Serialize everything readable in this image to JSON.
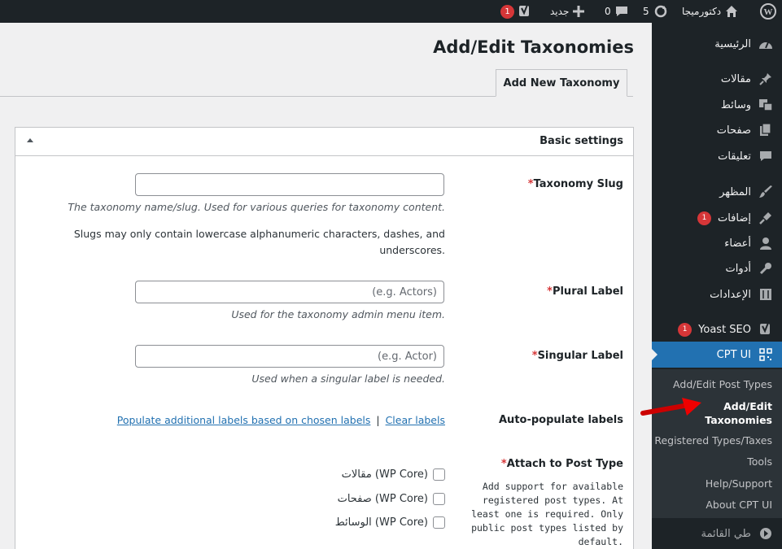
{
  "adminbar": {
    "wp_logo": "wordpress-icon",
    "site_name": "دكتورميجا",
    "updates_count": "5",
    "comments_count": "0",
    "new_label": "جديد",
    "yoast_badge": "1"
  },
  "sidebar": {
    "items": [
      {
        "label": "الرئيسية",
        "icon": "dashboard-icon"
      },
      {
        "label": "مقالات",
        "icon": "pin-icon"
      },
      {
        "label": "وسائط",
        "icon": "media-icon"
      },
      {
        "label": "صفحات",
        "icon": "pages-icon"
      },
      {
        "label": "تعليقات",
        "icon": "comments-icon"
      },
      {
        "label": "المظهر",
        "icon": "appearance-icon"
      },
      {
        "label": "إضافات",
        "icon": "plugins-icon",
        "badge": "1"
      },
      {
        "label": "أعضاء",
        "icon": "users-icon"
      },
      {
        "label": "أدوات",
        "icon": "tools-icon"
      },
      {
        "label": "الإعدادات",
        "icon": "settings-icon"
      },
      {
        "label": "Yoast SEO",
        "icon": "yoast-icon",
        "badge": "1"
      },
      {
        "label": "CPT UI",
        "icon": "cptui-icon"
      }
    ],
    "submenu": [
      "Add/Edit Post Types",
      "Add/Edit Taxonomies",
      "Registered Types/Taxes",
      "Tools",
      "Help/Support",
      "About CPT UI"
    ],
    "collapse_label": "طي القائمة"
  },
  "page": {
    "title": "Add/Edit Taxonomies",
    "tab": "Add New Taxonomy"
  },
  "box": {
    "title": "Basic settings",
    "slug_label": "Taxonomy Slug",
    "slug_desc": "The taxonomy name/slug. Used for various queries for taxonomy content.",
    "slug_note": "Slugs may only contain lowercase alphanumeric characters, dashes, and underscores.",
    "plural_label": "Plural Label",
    "plural_placeholder": "(e.g. Actors)",
    "plural_desc": "Used for the taxonomy admin menu item.",
    "singular_label": "Singular Label",
    "singular_placeholder": "(e.g. Actor)",
    "singular_desc": "Used when a singular label is needed.",
    "autopop_label": "Auto-populate labels",
    "autopop_link": "Populate additional labels based on chosen labels",
    "separator": "|",
    "clear_link": "Clear labels",
    "attach_label": "Attach to Post Type",
    "attach_help": "Add support for available registered post types. At least one is required. Only public post types listed by default.",
    "post_types": [
      "مقالات (WP Core)",
      "صفحات (WP Core)",
      "الوسائط (WP Core)"
    ]
  }
}
